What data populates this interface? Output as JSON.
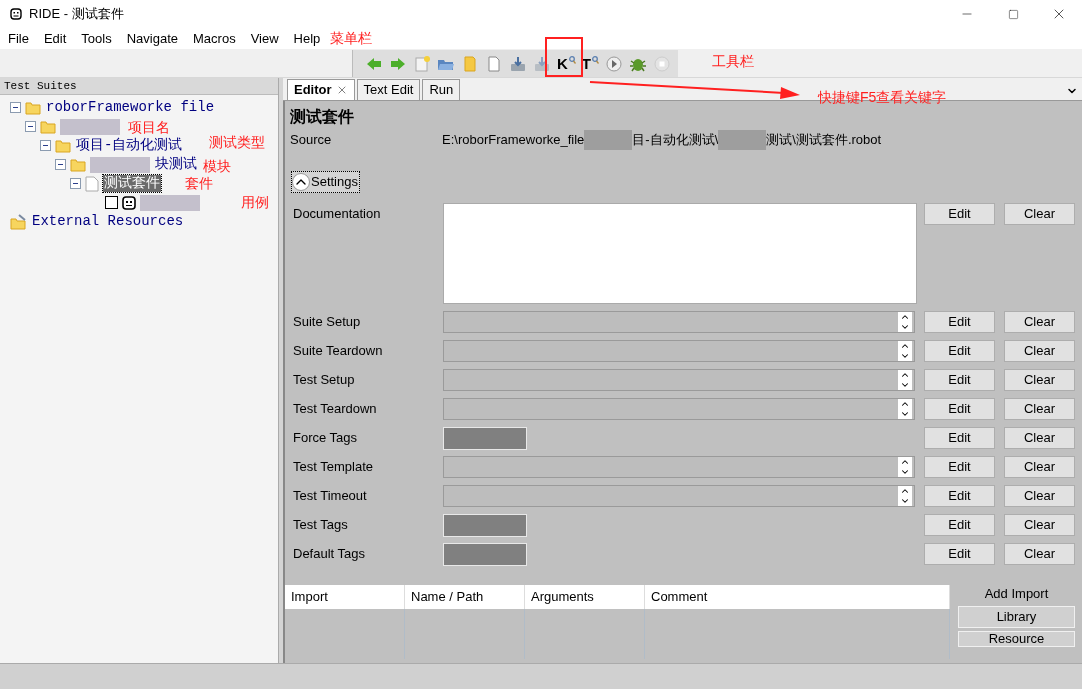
{
  "window": {
    "title": "RIDE - 测试套件"
  },
  "menu": [
    "File",
    "Edit",
    "Tools",
    "Navigate",
    "Macros",
    "View",
    "Help"
  ],
  "toolbar": [
    {
      "kind": "back"
    },
    {
      "kind": "forward"
    },
    {
      "kind": "new"
    },
    {
      "kind": "open"
    },
    {
      "kind": "folder"
    },
    {
      "kind": "page"
    },
    {
      "kind": "save"
    },
    {
      "kind": "save_all"
    },
    {
      "kind": "search",
      "label": "K"
    },
    {
      "kind": "search",
      "label": "T"
    },
    {
      "kind": "run"
    },
    {
      "kind": "debug"
    },
    {
      "kind": "stop"
    }
  ],
  "tree": {
    "title": "Test Suites",
    "nodes": [
      {
        "kind": "folder",
        "label": "roborFrameworke file",
        "expanded": true,
        "selected": false,
        "children": [
          {
            "kind": "folder",
            "blurred": true,
            "expanded": true,
            "selected": false,
            "children": [
              {
                "kind": "folder",
                "label": "项目-自动化测试",
                "expanded": true,
                "selected": false,
                "children": [
                  {
                    "kind": "folder",
                    "blurred": true,
                    "label": "块测试",
                    "expanded": true,
                    "selected": false,
                    "children": [
                      {
                        "kind": "file",
                        "label": "测试套件",
                        "expanded": true,
                        "selected": true,
                        "children": [
                          {
                            "kind": "test",
                            "blurred": true,
                            "checked": false,
                            "selected": false
                          }
                        ]
                      }
                    ]
                  }
                ]
              }
            ]
          }
        ]
      },
      {
        "kind": "resource",
        "label": "External Resources",
        "selected": false
      }
    ]
  },
  "tabs": [
    {
      "label": "Editor",
      "selected": true,
      "closable": true
    },
    {
      "label": "Text Edit",
      "selected": false,
      "closable": false
    },
    {
      "label": "Run",
      "selected": false,
      "closable": false
    }
  ],
  "editor": {
    "heading": "测试套件",
    "source": {
      "label": "Source",
      "segments": [
        {
          "text": "E:\\roborFrameworke_file"
        },
        {
          "kind": "blurred"
        },
        {
          "text": "目-自动化测试\\"
        },
        {
          "kind": "blurred"
        },
        {
          "text": "测试\\测试套件.robot"
        }
      ]
    },
    "settings_toggle": {
      "label": "Settings",
      "expanded": true
    },
    "settings": [
      {
        "label": "Documentation",
        "kind": "text",
        "edit": "Edit",
        "clear": "Clear"
      },
      {
        "label": "Suite Setup",
        "kind": "combo",
        "edit": "Edit",
        "clear": "Clear"
      },
      {
        "label": "Suite Teardown",
        "kind": "combo",
        "edit": "Edit",
        "clear": "Clear"
      },
      {
        "label": "Test Setup",
        "kind": "combo",
        "edit": "Edit",
        "clear": "Clear"
      },
      {
        "label": "Test Teardown",
        "kind": "combo",
        "edit": "Edit",
        "clear": "Clear"
      },
      {
        "label": "Force Tags",
        "kind": "tags",
        "edit": "Edit",
        "clear": "Clear"
      },
      {
        "label": "Test Template",
        "kind": "combo",
        "edit": "Edit",
        "clear": "Clear"
      },
      {
        "label": "Test Timeout",
        "kind": "combo",
        "edit": "Edit",
        "clear": "Clear"
      },
      {
        "label": "Test Tags",
        "kind": "tags",
        "edit": "Edit",
        "clear": "Clear"
      },
      {
        "label": "Default Tags",
        "kind": "tags",
        "edit": "Edit",
        "clear": "Clear"
      }
    ],
    "imports": {
      "columns": [
        "Import",
        "Name / Path",
        "Arguments",
        "Comment"
      ],
      "add_title": "Add Import",
      "buttons": [
        "Library",
        "Resource"
      ]
    }
  },
  "annotations": [
    "菜单栏",
    "工具栏",
    "快捷键F5查看关键字",
    "项目名",
    "测试类型",
    "模块",
    "套件",
    "用例"
  ]
}
